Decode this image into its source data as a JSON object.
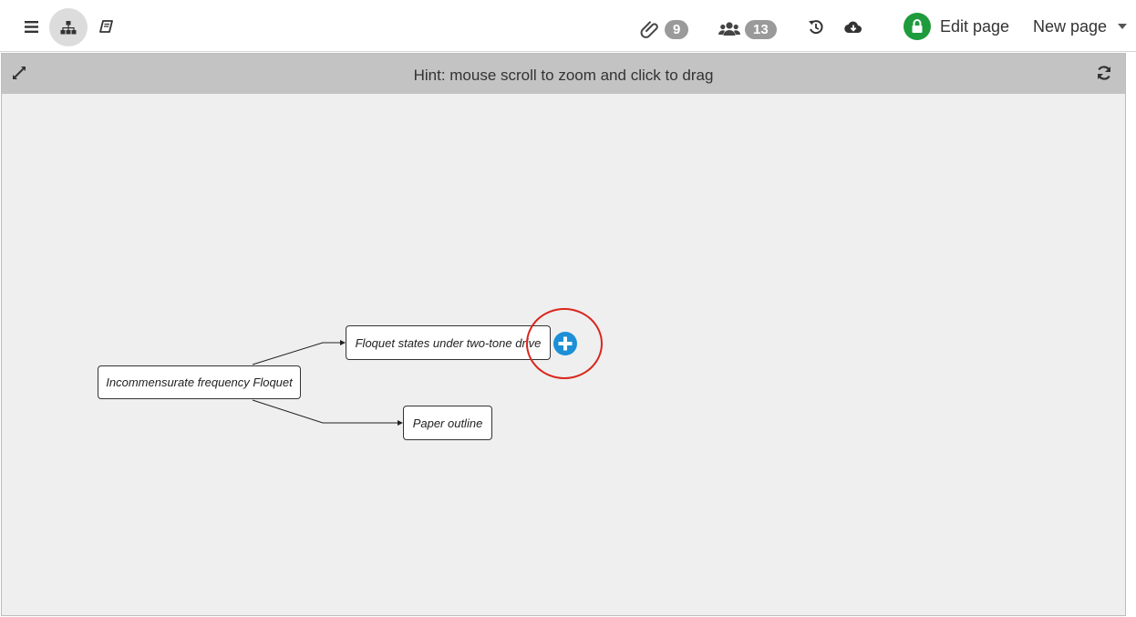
{
  "toolbar": {
    "menu_icon": "hamburger-menu-icon",
    "map_icon": "sitemap-icon",
    "book_icon": "book-icon",
    "attachments": {
      "icon": "paperclip-icon",
      "count": "9"
    },
    "collaborators": {
      "icon": "users-icon",
      "count": "13"
    },
    "history_icon": "history-icon",
    "download_icon": "cloud-download-icon",
    "edit_page": {
      "icon": "lock-icon",
      "label": "Edit page",
      "color": "#1e9b3c"
    },
    "new_page": {
      "label": "New page",
      "icon": "caret-down-icon"
    }
  },
  "panel": {
    "hint": "Hint: mouse scroll to zoom and click to drag",
    "expand_icon": "expand-icon",
    "refresh_icon": "refresh-icon"
  },
  "mindmap": {
    "root": {
      "label": "Incommensurate frequency Floquet"
    },
    "children": [
      {
        "label": "Floquet states under two-tone drive"
      },
      {
        "label": "Paper outline"
      }
    ],
    "add_button": {
      "icon": "plus-circle-icon",
      "color": "#1c8fd6"
    },
    "highlight_color": "#d9261c"
  }
}
